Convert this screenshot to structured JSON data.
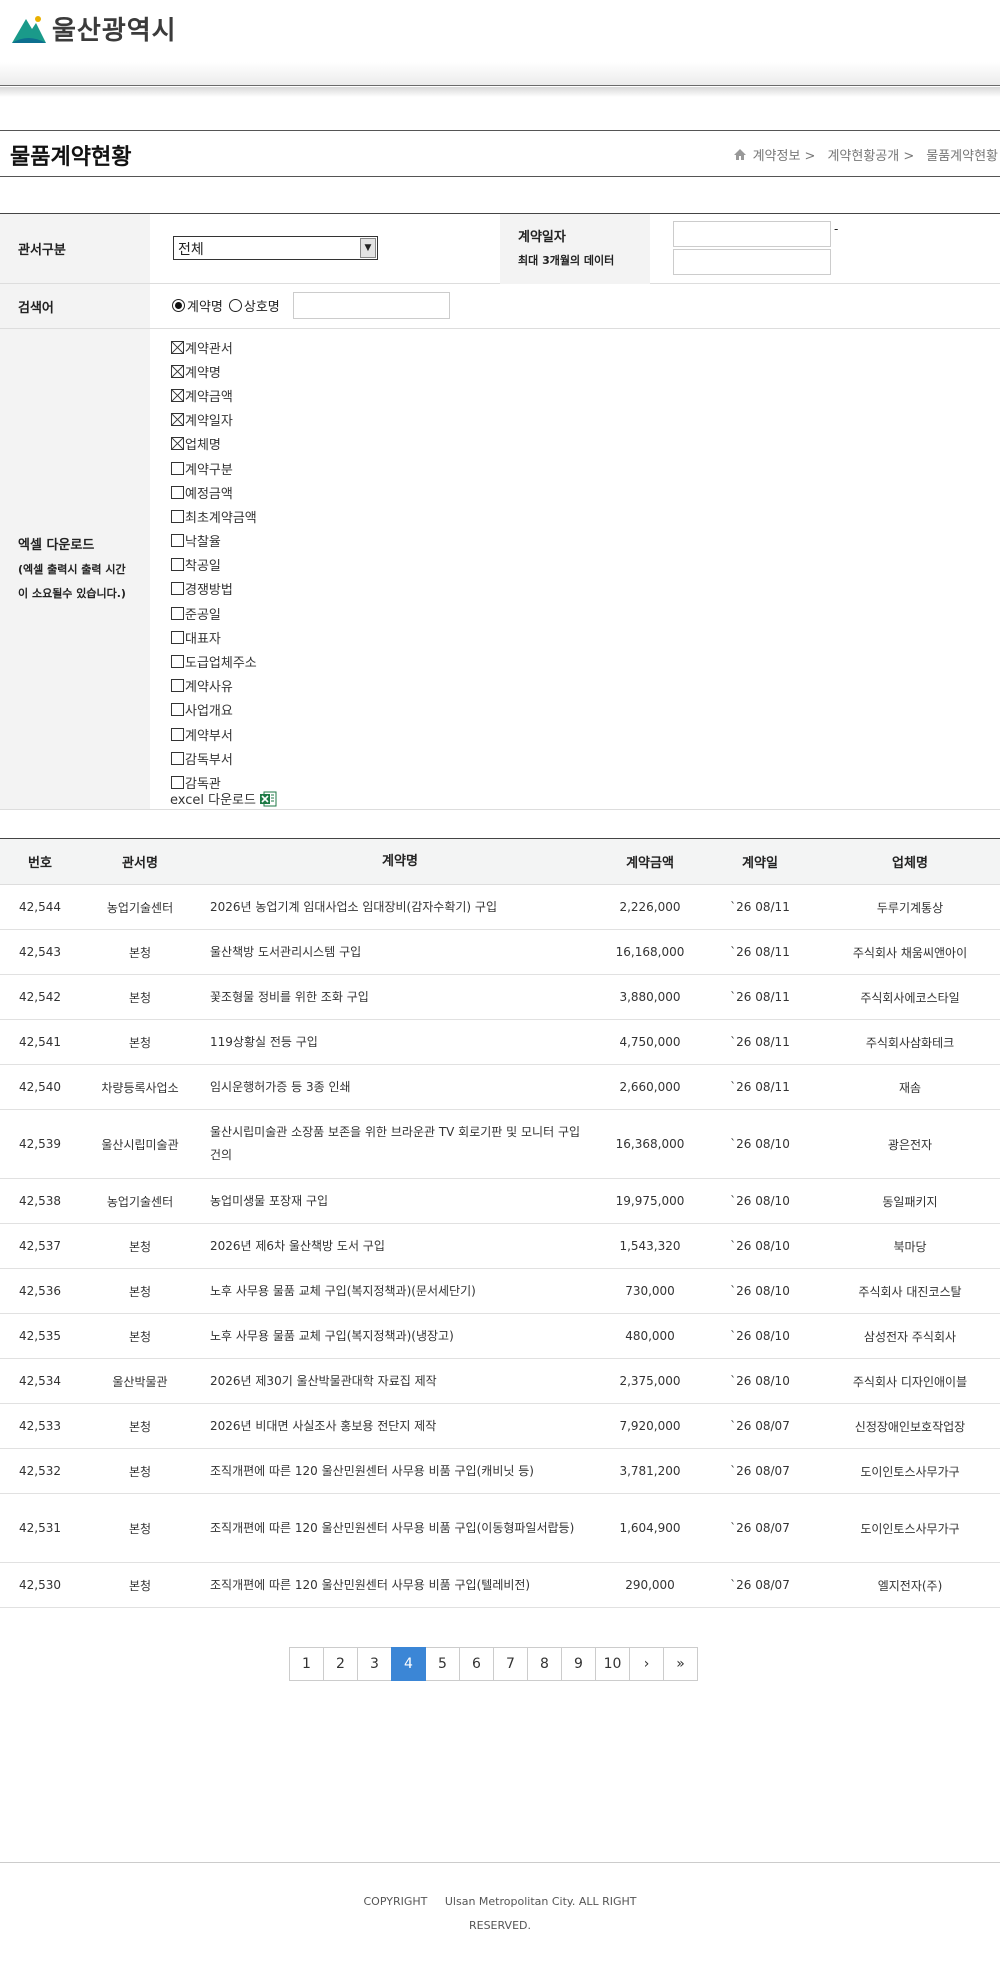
{
  "header": {
    "logo_text": "울산광역시",
    "brand_color": "#1a9a8a"
  },
  "title_bar": {
    "title": "물품계약현황",
    "breadcrumb": [
      "계약정보 >",
      "계약현황공개 >",
      "물품계약현황"
    ]
  },
  "search": {
    "office_label": "관서구분",
    "office_selected": "전체",
    "date_label": "계약일자",
    "date_note": "최대 3개월의 데이터",
    "date_dash": "-",
    "keyword_label": "검색어",
    "radio_contract": "계약명",
    "radio_company": "상호명",
    "excel_label": "엑셀 다운로드",
    "excel_note_1": "(엑셀 출력시 출력 시간",
    "excel_note_2": "이 소요될수 있습니다.)",
    "excel_fields": [
      {
        "label": "계약관서",
        "checked": true
      },
      {
        "label": "계약명",
        "checked": true
      },
      {
        "label": "계약금액",
        "checked": true
      },
      {
        "label": "계약일자",
        "checked": true
      },
      {
        "label": "업체명",
        "checked": true
      },
      {
        "label": "계약구분",
        "checked": false
      },
      {
        "label": "예정금액",
        "checked": false
      },
      {
        "label": "최초계약금액",
        "checked": false
      },
      {
        "label": "낙찰율",
        "checked": false
      },
      {
        "label": "착공일",
        "checked": false
      },
      {
        "label": "경쟁방법",
        "checked": false
      },
      {
        "label": "준공일",
        "checked": false
      },
      {
        "label": "대표자",
        "checked": false
      },
      {
        "label": "도급업체주소",
        "checked": false
      },
      {
        "label": "계약사유",
        "checked": false
      },
      {
        "label": "사업개요",
        "checked": false
      },
      {
        "label": "계약부서",
        "checked": false
      },
      {
        "label": "감독부서",
        "checked": false
      },
      {
        "label": "감독관",
        "checked": false
      }
    ],
    "excel_download": "excel 다운로드"
  },
  "table": {
    "headers": [
      "번호",
      "관서명",
      "계약명",
      "계약금액",
      "계약일",
      "업체명"
    ],
    "rows": [
      [
        "42,544",
        "농업기술센터",
        "2026년 농업기계 임대사업소 임대장비(감자수확기) 구입",
        "2,226,000",
        "`26 08/11",
        "두루기계통상"
      ],
      [
        "42,543",
        "본청",
        "울산책방 도서관리시스템 구입",
        "16,168,000",
        "`26 08/11",
        "주식회사 채움씨앤아이"
      ],
      [
        "42,542",
        "본청",
        "꽃조형물 정비를 위한 조화 구입",
        "3,880,000",
        "`26 08/11",
        "주식회사에코스타일"
      ],
      [
        "42,541",
        "본청",
        "119상황실 전등 구입",
        "4,750,000",
        "`26 08/11",
        "주식회사삼화테크"
      ],
      [
        "42,540",
        "차량등록사업소",
        "임시운행허가증 등 3종 인쇄",
        "2,660,000",
        "`26 08/11",
        "재솜"
      ],
      [
        "42,539",
        "울산시립미술관",
        "울산시립미술관 소장품 보존을 위한 브라운관 TV 회로기판 및 모니터 구입 건의",
        "16,368,000",
        "`26 08/10",
        "광은전자"
      ],
      [
        "42,538",
        "농업기술센터",
        "농업미생물 포장재 구입",
        "19,975,000",
        "`26 08/10",
        "동일패키지"
      ],
      [
        "42,537",
        "본청",
        "2026년 제6차 울산책방 도서 구입",
        "1,543,320",
        "`26 08/10",
        "북마당"
      ],
      [
        "42,536",
        "본청",
        "노후 사무용 물품 교체 구입(복지정책과)(문서세단기)",
        "730,000",
        "`26 08/10",
        "주식회사 대진코스탈"
      ],
      [
        "42,535",
        "본청",
        "노후 사무용 물품 교체 구입(복지정책과)(냉장고)",
        "480,000",
        "`26 08/10",
        "삼성전자 주식회사"
      ],
      [
        "42,534",
        "울산박물관",
        "2026년 제30기 울산박물관대학 자료집 제작",
        "2,375,000",
        "`26 08/10",
        "주식회사 디자인애이블"
      ],
      [
        "42,533",
        "본청",
        "2026년 비대면 사실조사 홍보용 전단지 제작",
        "7,920,000",
        "`26 08/07",
        "신정장애인보호작업장"
      ],
      [
        "42,532",
        "본청",
        "조직개편에 따른 120 울산민원센터 사무용 비품 구입(캐비닛 등)",
        "3,781,200",
        "`26 08/07",
        "도이인토스사무가구"
      ],
      [
        "42,531",
        "본청",
        "조직개편에 따른 120 울산민원센터 사무용 비품 구입(이동형파일서랍등)",
        "1,604,900",
        "`26 08/07",
        "도이인토스사무가구"
      ],
      [
        "42,530",
        "본청",
        "조직개편에 따른 120 울산민원센터 사무용 비품 구입(텔레비전)",
        "290,000",
        "`26 08/07",
        "엘지전자(주)"
      ]
    ]
  },
  "pagination": {
    "pages": [
      "1",
      "2",
      "3",
      "4",
      "5",
      "6",
      "7",
      "8",
      "9",
      "10"
    ],
    "current": "4",
    "next": "›",
    "last": "»",
    "active_color": "#3b86d6"
  },
  "footer": {
    "copyright": "COPYRIGHT",
    "line1": "Ulsan Metropolitan City. ALL RIGHT",
    "line2": "RESERVED."
  }
}
